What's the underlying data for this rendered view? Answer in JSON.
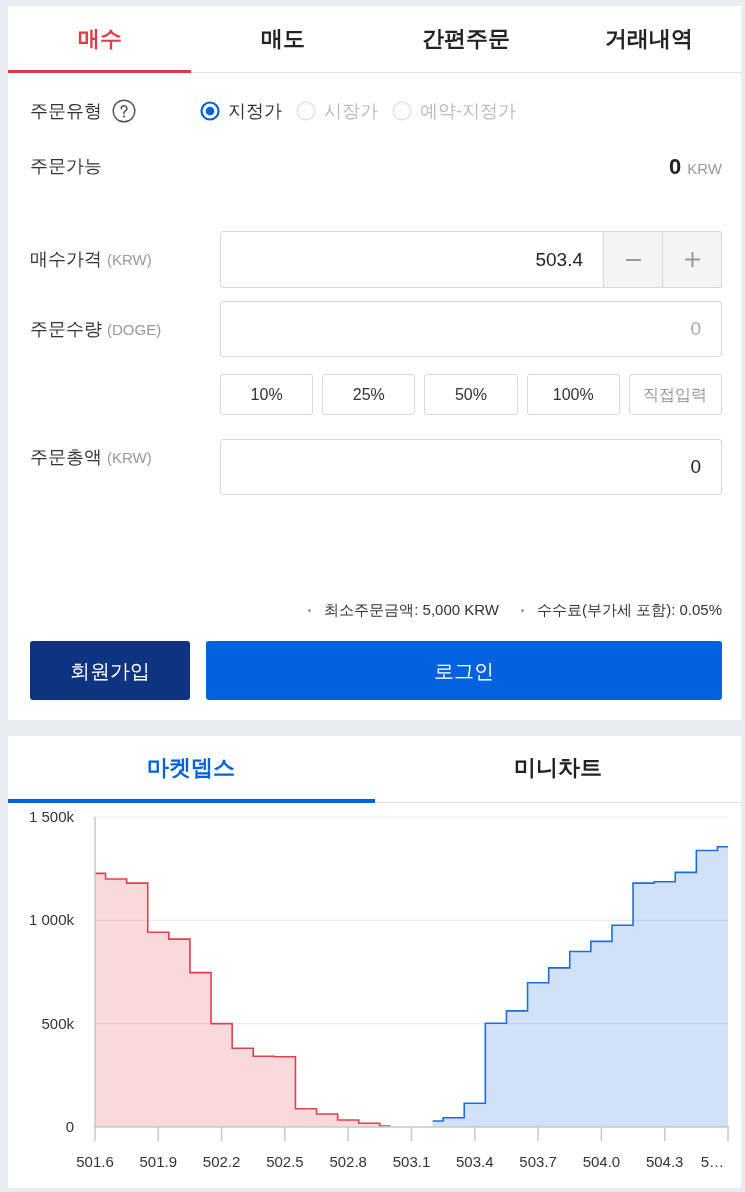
{
  "order_tabs": [
    {
      "label": "매수",
      "selected": true
    },
    {
      "label": "매도",
      "selected": false
    },
    {
      "label": "간편주문",
      "selected": false
    },
    {
      "label": "거래내역",
      "selected": false
    }
  ],
  "order_type": {
    "label": "주문유형",
    "options": [
      {
        "label": "지정가",
        "selected": true,
        "disabled": false
      },
      {
        "label": "시장가",
        "selected": false,
        "disabled": true
      },
      {
        "label": "예약-지정가",
        "selected": false,
        "disabled": true
      }
    ]
  },
  "available": {
    "label": "주문가능",
    "amount": "0",
    "unit": "KRW"
  },
  "price": {
    "label": "매수가격",
    "unit": "(KRW)",
    "value": "503.4"
  },
  "quantity": {
    "label": "주문수량",
    "unit": "(DOGE)",
    "placeholder": "0"
  },
  "percent_buttons": [
    {
      "label": "10%",
      "kind": "preset"
    },
    {
      "label": "25%",
      "kind": "preset"
    },
    {
      "label": "50%",
      "kind": "preset"
    },
    {
      "label": "100%",
      "kind": "preset"
    },
    {
      "label": "직접입력",
      "kind": "custom"
    }
  ],
  "total": {
    "label": "주문총액",
    "unit": "(KRW)",
    "value": "0"
  },
  "notes": [
    "최소주문금액: 5,000 KRW",
    "수수료(부가세 포함): 0.05%"
  ],
  "buttons": [
    {
      "label": "회원가입",
      "kind": "signup"
    },
    {
      "label": "로그인",
      "kind": "login"
    }
  ],
  "market_tabs": [
    {
      "label": "마켓뎁스",
      "selected": true
    },
    {
      "label": "미니차트",
      "selected": false
    }
  ],
  "market_depth": {
    "chart_data": {
      "type": "area",
      "x": [
        501.6,
        501.65,
        501.65,
        501.75,
        501.75,
        501.85,
        501.85,
        501.95,
        501.95,
        502.05,
        502.05,
        502.15,
        502.15,
        502.25,
        502.25,
        502.35,
        502.35,
        502.45,
        502.45,
        502.55,
        502.55,
        502.65,
        502.65,
        502.75,
        502.75,
        502.85,
        502.85,
        502.95,
        502.95,
        503.0,
        503.2,
        503.25,
        503.25,
        503.35,
        503.35,
        503.45,
        503.45,
        503.55,
        503.55,
        503.65,
        503.65,
        503.75,
        503.75,
        503.85,
        503.85,
        503.95,
        503.95,
        504.05,
        504.05,
        504.15,
        504.15,
        504.25,
        504.25,
        504.35,
        504.35,
        504.45,
        504.45,
        504.55,
        504.55,
        504.6
      ],
      "series": [
        {
          "color": "#e3404b",
          "values": [
            1227000,
            1227000,
            1200000,
            1200000,
            1180000,
            1180000,
            942000,
            942000,
            909000,
            909000,
            747000,
            747000,
            500000,
            500000,
            381000,
            381000,
            342000,
            342000,
            340000,
            340000,
            88000,
            88000,
            63000,
            63000,
            34000,
            34000,
            18000,
            18000,
            5000,
            5000,
            null,
            null,
            null,
            null,
            null,
            null,
            null,
            null,
            null,
            null,
            null,
            null,
            null,
            null,
            null,
            null,
            null,
            null,
            null,
            null,
            null,
            null,
            null,
            null,
            null,
            null,
            null,
            null,
            null,
            null
          ]
        },
        {
          "color": "#1b6fdd",
          "values": [
            null,
            null,
            null,
            null,
            null,
            null,
            null,
            null,
            null,
            null,
            null,
            null,
            null,
            null,
            null,
            null,
            null,
            null,
            null,
            null,
            null,
            null,
            null,
            null,
            null,
            null,
            null,
            null,
            null,
            null,
            29000,
            29000,
            45000,
            45000,
            115000,
            115000,
            502000,
            502000,
            562000,
            562000,
            698000,
            698000,
            770000,
            770000,
            849000,
            849000,
            898000,
            898000,
            976000,
            976000,
            1180000,
            1180000,
            1187000,
            1187000,
            1232000,
            1232000,
            1338000,
            1338000,
            1356000,
            1356000
          ]
        }
      ],
      "xlim": [
        501.6,
        504.6
      ],
      "ylim": [
        0,
        1500000
      ],
      "xticks": [
        501.6,
        501.9,
        502.2,
        502.5,
        502.8,
        503.1,
        503.4,
        503.7,
        {
          "value": 504.0,
          "label": "504.0"
        },
        504.3,
        {
          "value": 504.6,
          "label": "5…"
        }
      ],
      "yticks": [
        {
          "value": 0,
          "label": "0"
        },
        {
          "value": 500000,
          "label": "500k"
        },
        {
          "value": 1000000,
          "label": "1 000k"
        },
        {
          "value": 1500000,
          "label": "1 500k"
        }
      ]
    }
  }
}
